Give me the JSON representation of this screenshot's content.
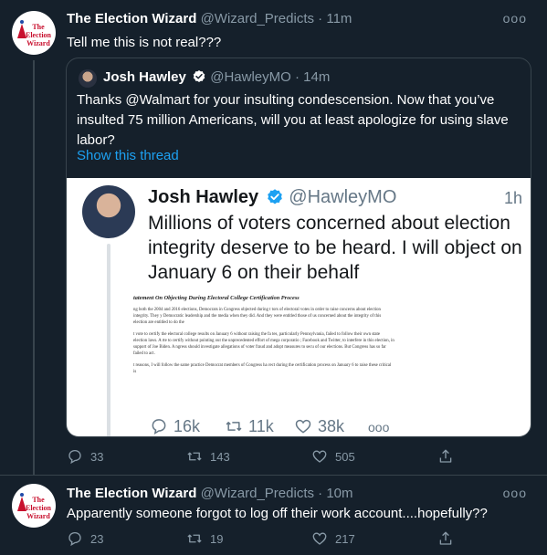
{
  "tweets": [
    {
      "author_name": "The Election Wizard",
      "handle": "@Wizard_Predicts",
      "time": "11m",
      "avatar_text": [
        "The",
        "Election",
        "Wizard"
      ],
      "text": "Tell me this is not real???",
      "quoted": {
        "author_name": "Josh Hawley",
        "handle": "@HawleyMO",
        "time": "14m",
        "text": "Thanks @Walmart for your insulting condescension. Now that you’ve insulted 75 million Americans, will you at least apologize for using slave labor?",
        "link": "Show this thread",
        "image": {
          "name": "Josh Hawley",
          "handle": "@HawleyMO",
          "time": "1h",
          "text": "Millions of voters concerned about election integrity deserve to be heard. I will object on January 6 on their behalf",
          "doc_title": "tatement On Objecting During Electoral College Certification Process",
          "doc_paragraphs": [
            "ng both the 2004 and 2016 elections, Democrats in Congress objected during t tors of electoral votes in order to raise concerns about election integrity. They y Democratic leadership and the media when they did. And they were entitled those of us concerned about the integrity of this election are entitled to do the",
            "t vote to certify the electoral college results on January 6 without raising the fa tes, particularly Pennsylvania, failed to follow their own state election laws. A rte to certify without pointing out the unprecedented effort of mega corporatio ; Facebook and Twitter, to interfere in this election, in support of Joe Biden. A ngress should investigate allegations of voter fraud and adopt measures to secu of our elections. But Congress has so far failed to act.",
            "t reasons, I will follow the same practice Democrat members of Congress ha rect during the certification process on January 6 to raise these critical is"
          ],
          "counts": {
            "replies": "16k",
            "retweets": "11k",
            "likes": "38k"
          }
        }
      },
      "counts": {
        "replies": "33",
        "retweets": "143",
        "likes": "505"
      }
    },
    {
      "author_name": "The Election Wizard",
      "handle": "@Wizard_Predicts",
      "time": "10m",
      "avatar_text": [
        "The",
        "Election",
        "Wizard"
      ],
      "text": "Apparently someone forgot to log off their work account....hopefully??",
      "counts": {
        "replies": "23",
        "retweets": "19",
        "likes": "217"
      }
    }
  ],
  "separator": "·",
  "more_glyph": "ooo",
  "icons": [
    "reply-icon",
    "retweet-icon",
    "like-icon",
    "share-icon",
    "verified-badge-icon",
    "more-icon"
  ],
  "colors": {
    "background": "#15202b",
    "link": "#1da1f2",
    "muted": "#8899a6",
    "verified": "#1da1f2",
    "logo_red": "#c8102e"
  }
}
